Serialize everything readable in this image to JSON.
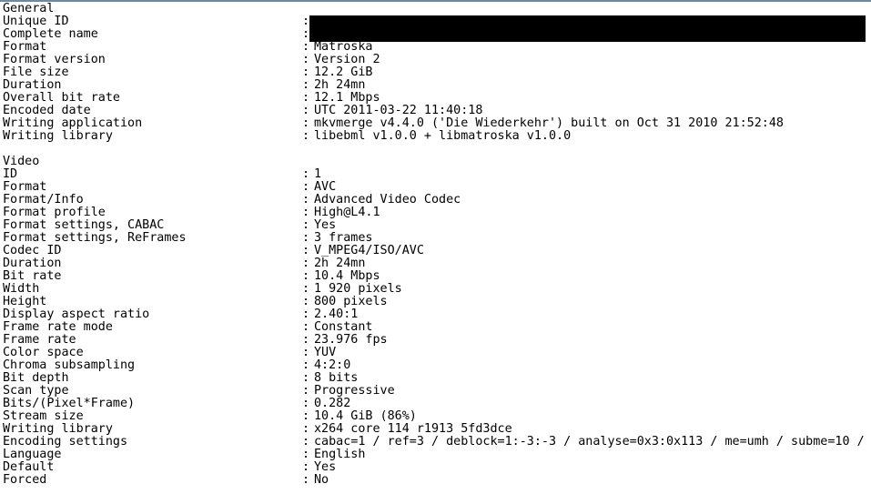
{
  "sections": [
    {
      "title": "General",
      "rows": [
        {
          "label": "Unique ID",
          "value": "",
          "redacted": true
        },
        {
          "label": "Complete name",
          "value": "",
          "redacted": true
        },
        {
          "label": "Format",
          "value": "Matroska"
        },
        {
          "label": "Format version",
          "value": "Version 2"
        },
        {
          "label": "File size",
          "value": "12.2 GiB"
        },
        {
          "label": "Duration",
          "value": "2h 24mn"
        },
        {
          "label": "Overall bit rate",
          "value": "12.1 Mbps"
        },
        {
          "label": "Encoded date",
          "value": "UTC 2011-03-22 11:40:18"
        },
        {
          "label": "Writing application",
          "value": "mkvmerge v4.4.0 ('Die Wiederkehr') built on Oct 31 2010 21:52:48"
        },
        {
          "label": "Writing library",
          "value": "libebml v1.0.0 + libmatroska v1.0.0"
        }
      ]
    },
    {
      "title": "Video",
      "rows": [
        {
          "label": "ID",
          "value": "1"
        },
        {
          "label": "Format",
          "value": "AVC"
        },
        {
          "label": "Format/Info",
          "value": "Advanced Video Codec"
        },
        {
          "label": "Format profile",
          "value": "High@L4.1"
        },
        {
          "label": "Format settings, CABAC",
          "value": "Yes"
        },
        {
          "label": "Format settings, ReFrames",
          "value": "3 frames"
        },
        {
          "label": "Codec ID",
          "value": "V_MPEG4/ISO/AVC"
        },
        {
          "label": "Duration",
          "value": "2h 24mn"
        },
        {
          "label": "Bit rate",
          "value": "10.4 Mbps"
        },
        {
          "label": "Width",
          "value": "1 920 pixels"
        },
        {
          "label": "Height",
          "value": "800 pixels"
        },
        {
          "label": "Display aspect ratio",
          "value": "2.40:1"
        },
        {
          "label": "Frame rate mode",
          "value": "Constant"
        },
        {
          "label": "Frame rate",
          "value": "23.976 fps"
        },
        {
          "label": "Color space",
          "value": "YUV"
        },
        {
          "label": "Chroma subsampling",
          "value": "4:2:0"
        },
        {
          "label": "Bit depth",
          "value": "8 bits"
        },
        {
          "label": "Scan type",
          "value": "Progressive"
        },
        {
          "label": "Bits/(Pixel*Frame)",
          "value": "0.282"
        },
        {
          "label": "Stream size",
          "value": "10.4 GiB (86%)"
        },
        {
          "label": "Writing library",
          "value": "x264 core 114 r1913 5fd3dce"
        },
        {
          "label": "Encoding settings",
          "value": "cabac=1 / ref=3 / deblock=1:-3:-3 / analyse=0x3:0x113 / me=umh / subme=10 / p"
        },
        {
          "label": "Language",
          "value": "English"
        },
        {
          "label": "Default",
          "value": "Yes"
        },
        {
          "label": "Forced",
          "value": "No"
        }
      ]
    }
  ],
  "separator": ":"
}
